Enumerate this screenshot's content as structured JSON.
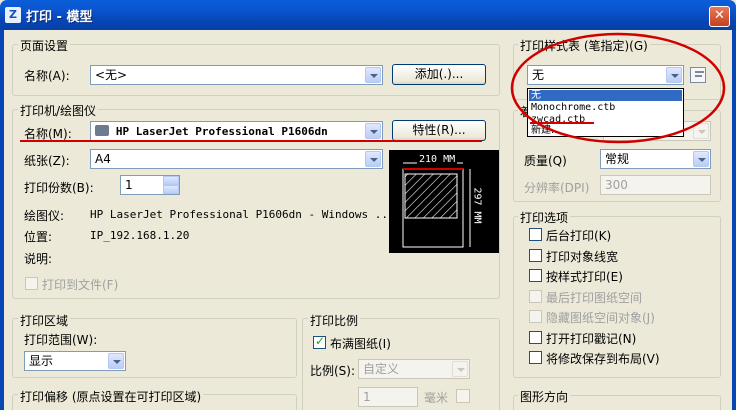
{
  "window": {
    "title": "打印 - 模型",
    "close_glyph": "✕"
  },
  "page_setup": {
    "group_title": "页面设置",
    "name_label": "名称(A):",
    "name_value": "<无>",
    "add_button": "添加(.)..."
  },
  "printer": {
    "group_title": "打印机/绘图仪",
    "name_label": "名称(M):",
    "name_value": "HP LaserJet Professional P1606dn",
    "properties_button": "特性(R)...",
    "paper_label": "纸张(Z):",
    "paper_value": "A4",
    "copies_label": "打印份数(B):",
    "copies_value": "1",
    "plotter_label": "绘图仪:",
    "plotter_value": "HP LaserJet Professional P1606dn - Windows ...",
    "location_label": "位置:",
    "location_value": "IP_192.168.1.20",
    "description_label": "说明:",
    "print_to_file": "打印到文件(F)"
  },
  "preview": {
    "width_label": "210 MM",
    "height_label": "297 MM"
  },
  "plot_area": {
    "group_title": "打印区域",
    "range_label": "打印范围(W):",
    "range_value": "显示"
  },
  "plot_scale": {
    "group_title": "打印比例",
    "fit_paper": "布满图纸(I)",
    "fit_checked": true,
    "scale_label": "比例(S):",
    "scale_value": "自定义",
    "value_1": "1",
    "unit": "毫米"
  },
  "plot_offset": {
    "group_title": "打印偏移 (原点设置在可打印区域)"
  },
  "style_table": {
    "group_title": "打印样式表 (笔指定)(G)",
    "value": "无",
    "options": [
      "无",
      "Monochrome.ctb",
      "zwcad.ctb",
      "新建..."
    ],
    "selected_index": 0
  },
  "shaded": {
    "partial_label": "着",
    "quality_label": "质量(Q)",
    "quality_value": "常规",
    "dpi_label": "分辨率(DPI)",
    "dpi_value": "300"
  },
  "plot_options": {
    "group_title": "打印选项",
    "items": [
      {
        "label": "后台打印(K)",
        "enabled": true
      },
      {
        "label": "打印对象线宽",
        "enabled": true
      },
      {
        "label": "按样式打印(E)",
        "enabled": true
      },
      {
        "label": "最后打印图纸空间",
        "enabled": false
      },
      {
        "label": "隐藏图纸空间对象(J)",
        "enabled": false
      },
      {
        "label": "打开打印戳记(N)",
        "enabled": true
      },
      {
        "label": "将修改保存到布局(V)",
        "enabled": true
      }
    ]
  },
  "orientation": {
    "group_title": "图形方向"
  },
  "colors": {
    "title_bar": "#0646b5",
    "annotation_red": "#d10000",
    "selection": "#316ac5"
  }
}
